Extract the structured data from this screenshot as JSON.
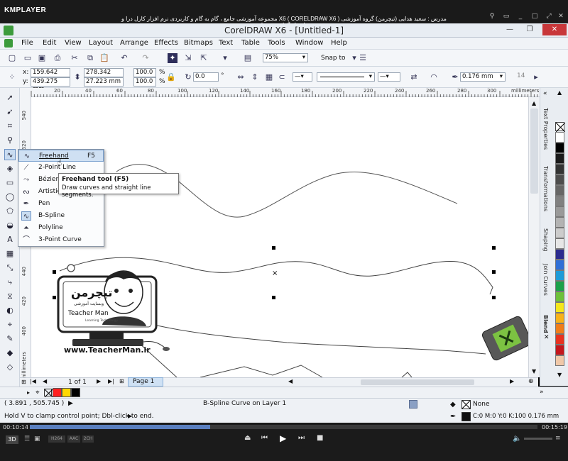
{
  "player": {
    "brand": "KMPLAYER",
    "title": "مجموعه آموزشی جامع ، گام به گام و کاربردی نرم افزار کارل درا و  X6 ( CORELDRAW X6 )  مدرس : سعید هدایی (تیچرمن) گروه آموزشی پادشاه گرافیست ها",
    "time_current": "00:10:14",
    "time_total": "00:15:19",
    "progress": 0.355,
    "badges": [
      "3D",
      "H264",
      "AAC",
      "2CH"
    ]
  },
  "app": {
    "title": "CorelDRAW X6 - [Untitled-1]"
  },
  "menu": [
    "File",
    "Edit",
    "View",
    "Layout",
    "Arrange",
    "Effects",
    "Bitmaps",
    "Text",
    "Table",
    "Tools",
    "Window",
    "Help"
  ],
  "toolbar": {
    "zoom": "75%",
    "snap_to": "Snap to"
  },
  "property_bar": {
    "x": "159.642 mm",
    "y": "439.275 mm",
    "w": "278.342 mm",
    "h": "27.223 mm",
    "scale_x": "100.0",
    "scale_y": "100.0",
    "pct": "%",
    "rotation": "0.0",
    "degree": "°",
    "outline_width": "0.176 mm",
    "curve_smoothing": "14"
  },
  "ruler": {
    "h_ticks": [
      "20",
      "40",
      "60",
      "80",
      "100",
      "120",
      "140",
      "160",
      "180",
      "200",
      "220",
      "240",
      "260",
      "280",
      "300"
    ],
    "units": "millimeters",
    "v_ticks": [
      "540",
      "520",
      "500",
      "480",
      "460",
      "440",
      "420",
      "400"
    ],
    "v_units": "millimeters"
  },
  "flyout": {
    "items": [
      {
        "label": "Freehand",
        "shortcut": "F5",
        "icon": "freehand-icon"
      },
      {
        "label": "2-Point Line",
        "shortcut": "",
        "icon": "2-point-line-icon"
      },
      {
        "label": "Bézier",
        "shortcut": "",
        "icon": "bezier-icon"
      },
      {
        "label": "Artistic Media",
        "shortcut": "",
        "icon": "artistic-media-icon"
      },
      {
        "label": "Pen",
        "shortcut": "",
        "icon": "pen-icon"
      },
      {
        "label": "B-Spline",
        "shortcut": "",
        "icon": "b-spline-icon"
      },
      {
        "label": "Polyline",
        "shortcut": "",
        "icon": "polyline-icon"
      },
      {
        "label": "3-Point Curve",
        "shortcut": "",
        "icon": "3-point-curve-icon"
      }
    ]
  },
  "tooltip": {
    "title": "Freehand tool (F5)",
    "body": "Draw curves and straight line segments."
  },
  "docker_tabs": [
    "Text Properties",
    "Transformations",
    "Shaping",
    "Join Curves",
    "Blend"
  ],
  "palette": [
    "#ffffff",
    "#000000",
    "#1a1a1a",
    "#333333",
    "#4d4d4d",
    "#666666",
    "#808080",
    "#999999",
    "#b3b3b3",
    "#cccccc",
    "#e6e6e6",
    "#2b2b8f",
    "#2f6fd6",
    "#1d9bd8",
    "#1aa14a",
    "#6dc13a",
    "#f4e61c",
    "#f7b21a",
    "#f07d1a",
    "#e8321f",
    "#c4161c",
    "#f0c8a8"
  ],
  "page": {
    "counter": "1 of 1",
    "tab": "Page 1"
  },
  "status": {
    "coords": "( 3.891 , 505.745 )",
    "object": "B-Spline Curve on Layer 1",
    "hint": "Hold V to clamp control point; Dbl-click to end.",
    "fill": "None",
    "outline": "C:0 M:0 Y:0 K:100  0.176 mm"
  },
  "doc_colors": [
    "#ffffff",
    "#ff2020",
    "#ffd800",
    "#000000"
  ],
  "logo": {
    "brand_fa": "تیچرمن",
    "sub_fa": "وبسایت آموزشی",
    "name": "Teacher Man",
    "tagline": "Learning Technology",
    "url": "www.TeacherMan.ir"
  }
}
